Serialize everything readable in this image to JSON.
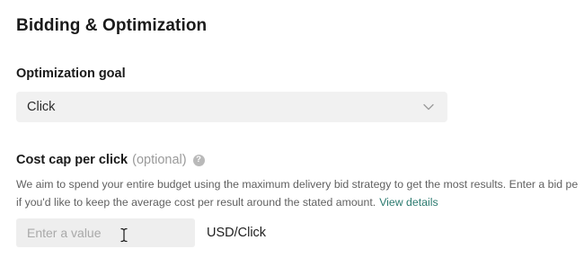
{
  "section": {
    "title": "Bidding & Optimization"
  },
  "optimization_goal": {
    "label": "Optimization goal",
    "selected_value": "Click",
    "icon": "chevron-down-icon"
  },
  "cost_cap": {
    "label": "Cost cap per click",
    "optional_text": "(optional)",
    "help_icon": "question-mark-icon",
    "description_line1": "We aim to spend your entire budget using the maximum delivery bid strategy to get the most results. Enter a bid pe",
    "description_line2": "if you'd like to keep the average cost per result around the stated amount.",
    "link_text": "View details",
    "input_placeholder": "Enter a value",
    "input_value": "",
    "unit": "USD/Click"
  },
  "colors": {
    "link": "#2b7a6f",
    "field_background": "#f1f1f1",
    "muted_text": "#9a9a9a"
  }
}
